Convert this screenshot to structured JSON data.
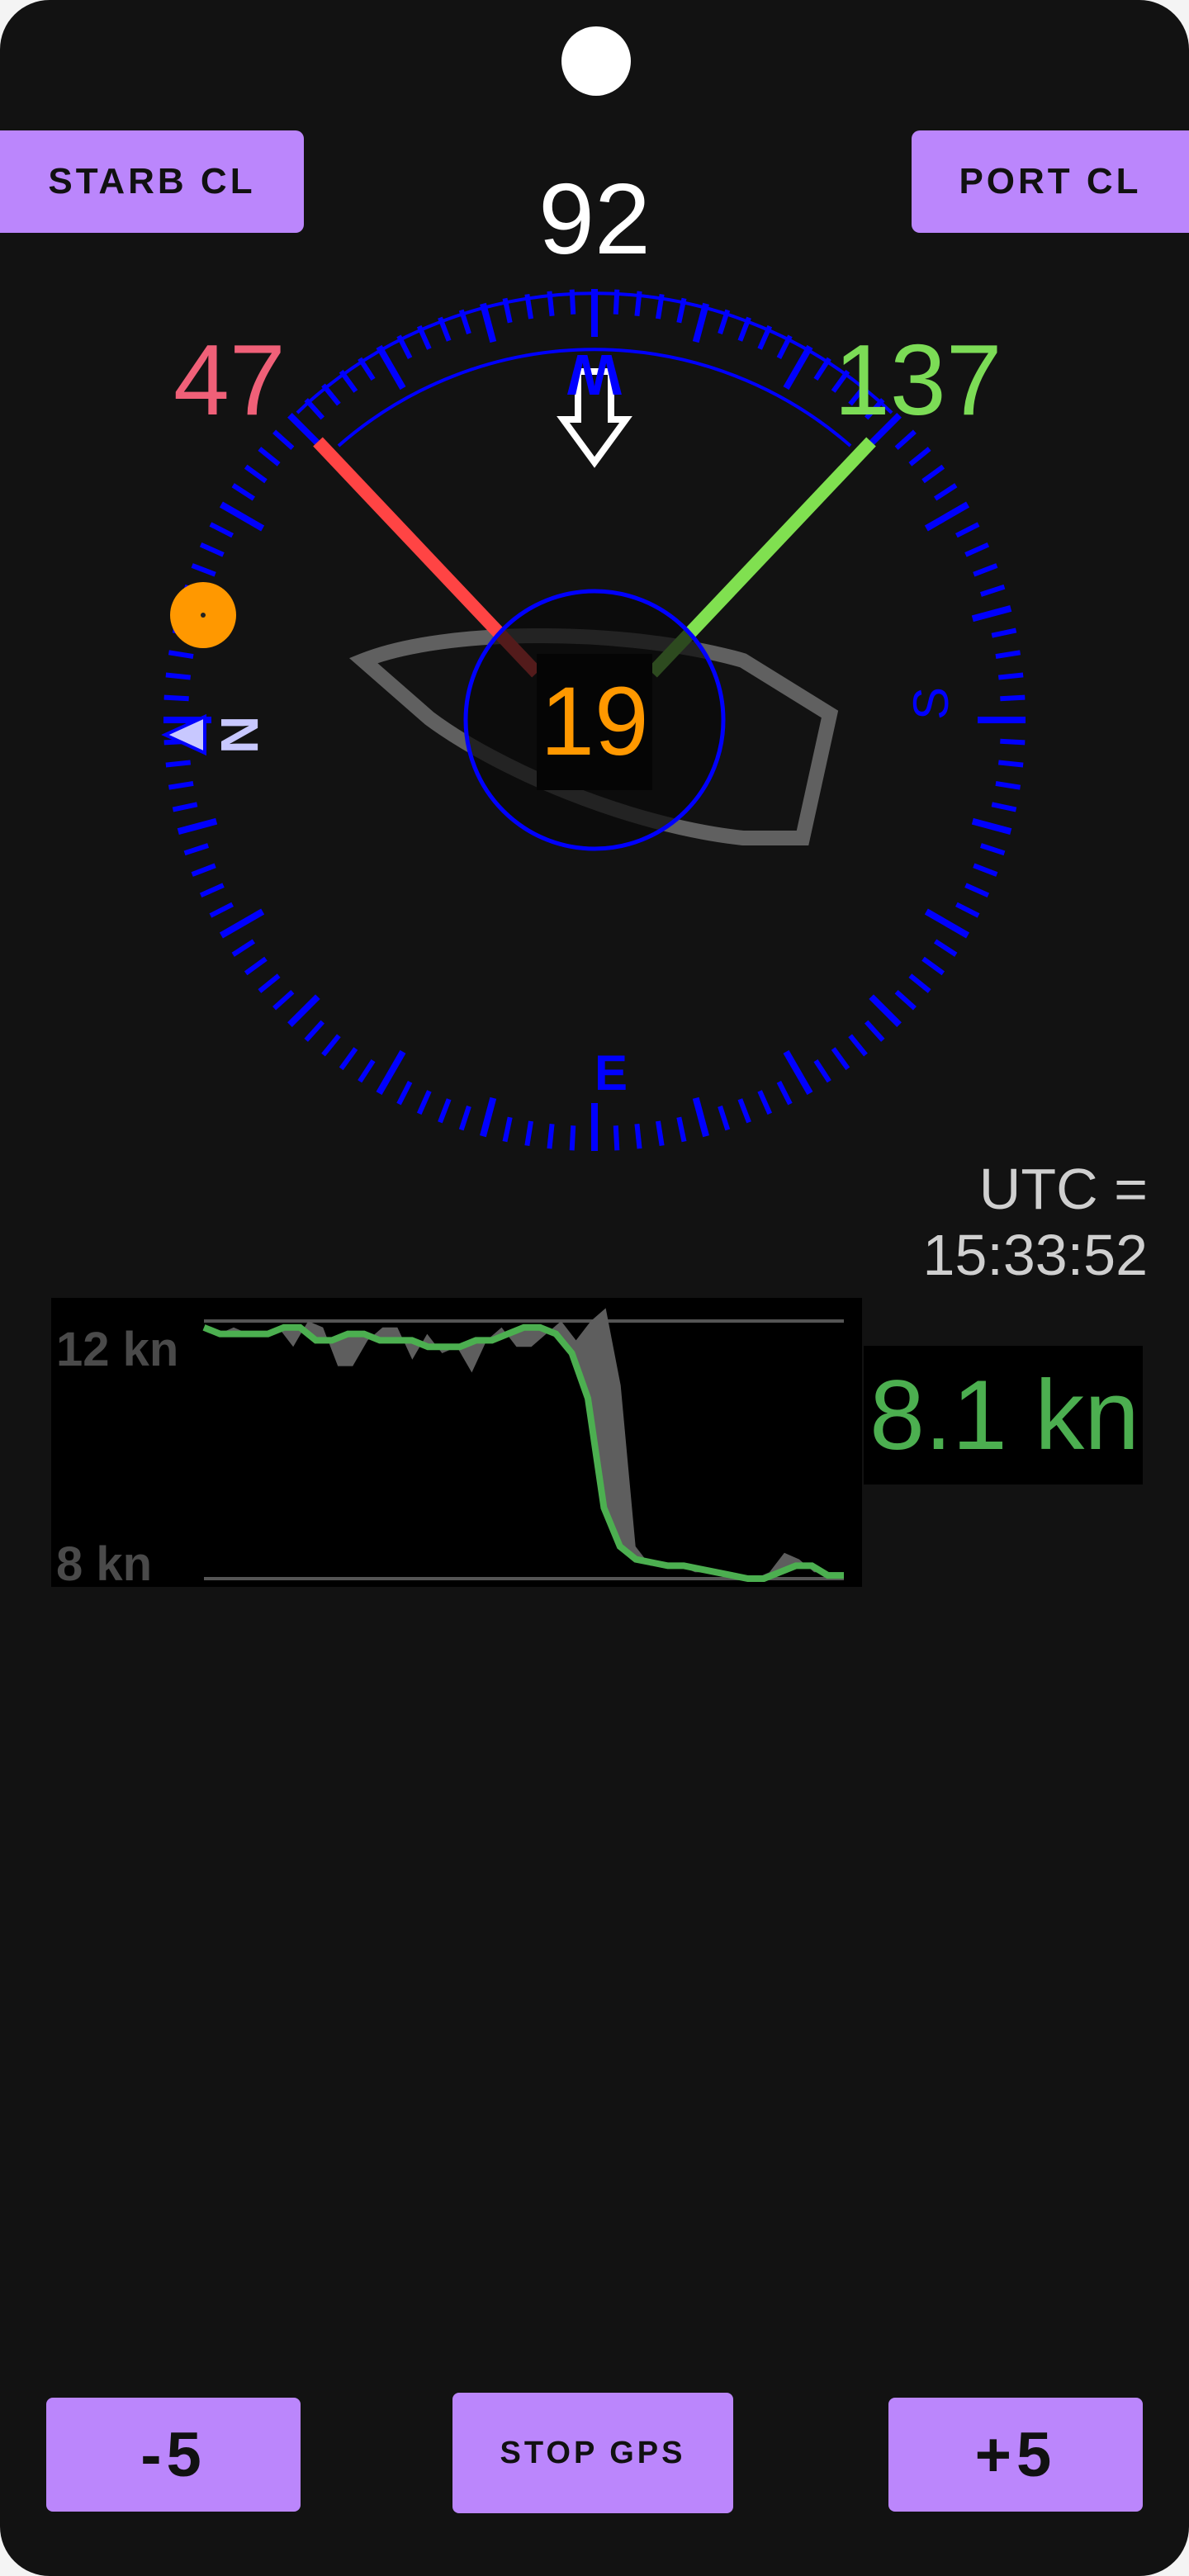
{
  "toolbar": {
    "starb_label": "STARB CL",
    "port_label": "PORT CL"
  },
  "compass": {
    "heading": "92",
    "starboard_angle": "47",
    "port_angle": "137",
    "center_value": "19",
    "cardinals": {
      "north": "N",
      "south": "S",
      "east": "E",
      "west": "W"
    },
    "colors": {
      "ring": "#0000ff",
      "starboard_line": "#ff4444",
      "port_line": "#80e050",
      "center_text": "#ff9800"
    }
  },
  "utc": "UTC = 15:33:52",
  "speed_chart": {
    "top_label": "12 kn",
    "bottom_label": "8 kn",
    "current_speed": "8.1 kn"
  },
  "bottom": {
    "minus_label": "-5",
    "gps_label": "STOP GPS",
    "plus_label": "+5"
  },
  "chart_data": {
    "type": "area",
    "ylim": [
      8,
      12
    ],
    "grid": true,
    "series": [
      {
        "values": [
          11.9,
          11.8,
          11.9,
          11.8,
          11.8,
          11.9,
          11.6,
          12.0,
          11.9,
          11.3,
          11.3,
          11.7,
          11.9,
          11.9,
          11.4,
          11.8,
          11.5,
          11.6,
          11.2,
          11.7,
          11.9,
          11.6,
          11.6,
          11.8,
          12.0,
          11.7,
          12.0,
          12.2,
          11.0,
          8.5,
          8.2,
          8.2,
          8.2,
          8.1,
          8.1,
          8.1,
          8.0,
          8.0,
          8.1,
          8.4,
          8.3,
          8.1,
          8.1,
          8.1
        ]
      },
      {
        "values": [
          11.9,
          11.8,
          11.8,
          11.8,
          11.8,
          11.9,
          11.9,
          11.7,
          11.7,
          11.8,
          11.8,
          11.7,
          11.7,
          11.7,
          11.6,
          11.6,
          11.6,
          11.7,
          11.7,
          11.8,
          11.9,
          11.9,
          11.8,
          11.5,
          10.8,
          9.1,
          8.5,
          8.3,
          8.25,
          8.2,
          8.2,
          8.15,
          8.1,
          8.05,
          8.0,
          8.0,
          8.1,
          8.2,
          8.2,
          8.05,
          8.05
        ]
      }
    ]
  }
}
